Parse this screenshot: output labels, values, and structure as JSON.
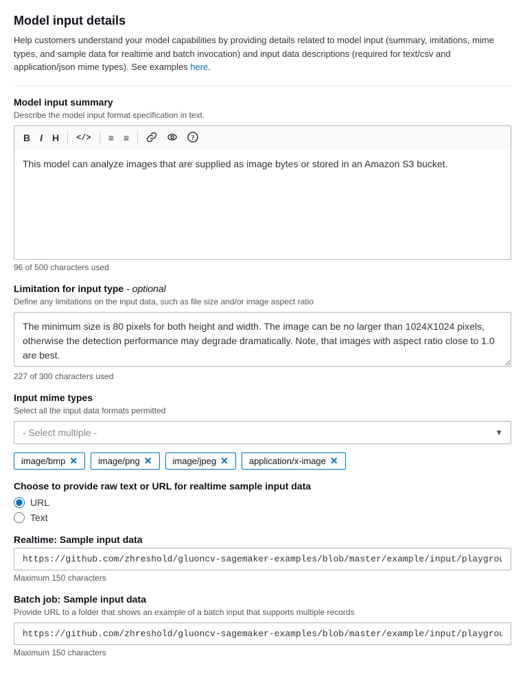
{
  "page": {
    "title": "Model input details",
    "description": "Help customers understand your model capabilities by providing details related to model input (summary, imitations, mime types, and sample data for realtime and batch invocation) and input data descriptions (required for text/csv and application/json mime types). See examples",
    "link_text": "here",
    "link_href": "#"
  },
  "summary_section": {
    "label": "Model input summary",
    "sublabel": "Describe the model input format specification in text.",
    "content": "This model can analyze images that are supplied as image bytes or stored in an Amazon S3 bucket.",
    "char_count": "96 of 500 characters used",
    "toolbar": {
      "bold": "B",
      "italic": "I",
      "heading": "H",
      "code": "</>",
      "ul": "≡",
      "ol": "≡",
      "link": "🔗",
      "preview": "👁",
      "help": "?"
    }
  },
  "limitation_section": {
    "label": "Limitation for input type",
    "optional": "- optional",
    "sublabel": "Define any limitations on the input data, such as file size and/or image aspect ratio",
    "content": "The minimum size is 80 pixels for both height and width. The image can be no larger than 1024X1024 pixels, otherwise the detection performance may degrade dramatically. Note, that images with aspect ratio close to 1.0 are best.",
    "char_count": "227 of 300 characters used"
  },
  "mime_section": {
    "label": "Input mime types",
    "sublabel": "Select all the input data formats permitted",
    "select_placeholder": "- Select multiple -",
    "tags": [
      {
        "id": "tag-bmp",
        "label": "image/bmp"
      },
      {
        "id": "tag-png",
        "label": "image/png"
      },
      {
        "id": "tag-jpeg",
        "label": "image/jpeg"
      },
      {
        "id": "tag-ximage",
        "label": "application/x-image"
      }
    ]
  },
  "sample_type_section": {
    "label": "Choose to provide raw text or URL for realtime sample input data",
    "options": [
      {
        "id": "opt-url",
        "value": "url",
        "label": "URL",
        "checked": true
      },
      {
        "id": "opt-text",
        "value": "text",
        "label": "Text",
        "checked": false
      }
    ]
  },
  "realtime_section": {
    "label": "Realtime: Sample input data",
    "value": "https://github.com/zhreshold/gluoncv-sagemaker-examples/blob/master/example/input/playground.jpg",
    "max_chars": "Maximum 150 characters"
  },
  "batch_section": {
    "label": "Batch job: Sample input data",
    "sublabel": "Provide URL to a folder that shows an example of a batch input that supports multiple records",
    "value": "https://github.com/zhreshold/gluoncv-sagemaker-examples/blob/master/example/input/playground.jpg",
    "max_chars": "Maximum 150 characters"
  }
}
